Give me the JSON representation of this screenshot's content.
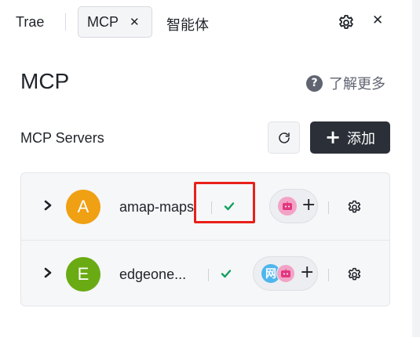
{
  "tabs": {
    "trae": "Trae",
    "mcp": "MCP",
    "agent": "智能体"
  },
  "heading": {
    "title": "MCP",
    "learn_more": "了解更多"
  },
  "servers_section": {
    "title": "MCP Servers",
    "add_label": "添加"
  },
  "servers": [
    {
      "avatar_letter": "A",
      "avatar_color": "#f0a013",
      "name": "amap-maps",
      "status": "connected"
    },
    {
      "avatar_letter": "E",
      "avatar_color": "#6aab14",
      "name": "edgeone...",
      "status": "connected",
      "tool_badge": "网"
    }
  ],
  "colors": {
    "success": "#12a05c",
    "primary_button": "#2b3038",
    "highlight": "#e8201a"
  }
}
